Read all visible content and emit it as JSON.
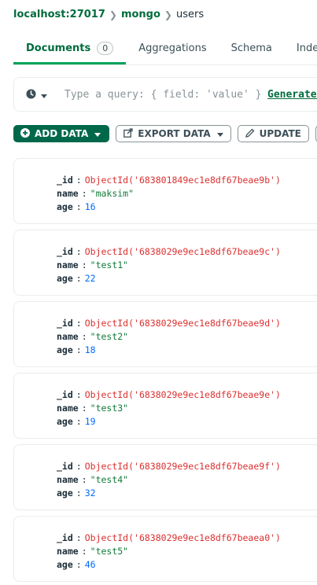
{
  "breadcrumb": {
    "host": "localhost:27017",
    "database": "mongo",
    "collection": "users"
  },
  "tabs": [
    {
      "label": "Documents",
      "count": "0",
      "active": true
    },
    {
      "label": "Aggregations"
    },
    {
      "label": "Schema"
    },
    {
      "label": "Indexes"
    }
  ],
  "query": {
    "placeholder": "Type a query: { field: 'value' } or",
    "generate_label": "Generate query"
  },
  "toolbar": {
    "add_data": "ADD DATA",
    "export_data": "EXPORT DATA",
    "update": "UPDATE"
  },
  "documents": [
    {
      "id_key": "_id",
      "id": "ObjectId('683801849ec1e8df67beae9b')",
      "name_key": "name",
      "name": "\"maksim\"",
      "age_key": "age",
      "age": "16"
    },
    {
      "id_key": "_id",
      "id": "ObjectId('6838029e9ec1e8df67beae9c')",
      "name_key": "name",
      "name": "\"test1\"",
      "age_key": "age",
      "age": "22"
    },
    {
      "id_key": "_id",
      "id": "ObjectId('6838029e9ec1e8df67beae9d')",
      "name_key": "name",
      "name": "\"test2\"",
      "age_key": "age",
      "age": "18"
    },
    {
      "id_key": "_id",
      "id": "ObjectId('6838029e9ec1e8df67beae9e')",
      "name_key": "name",
      "name": "\"test3\"",
      "age_key": "age",
      "age": "19"
    },
    {
      "id_key": "_id",
      "id": "ObjectId('6838029e9ec1e8df67beae9f')",
      "name_key": "name",
      "name": "\"test4\"",
      "age_key": "age",
      "age": "32"
    },
    {
      "id_key": "_id",
      "id": "ObjectId('6838029e9ec1e8df67beaea0')",
      "name_key": "name",
      "name": "\"test5\"",
      "age_key": "age",
      "age": "46"
    }
  ],
  "colors": {
    "brand_green": "#00684a",
    "objectid_red": "#db3030",
    "string_green": "#137a3a",
    "number_blue": "#016bf8"
  }
}
